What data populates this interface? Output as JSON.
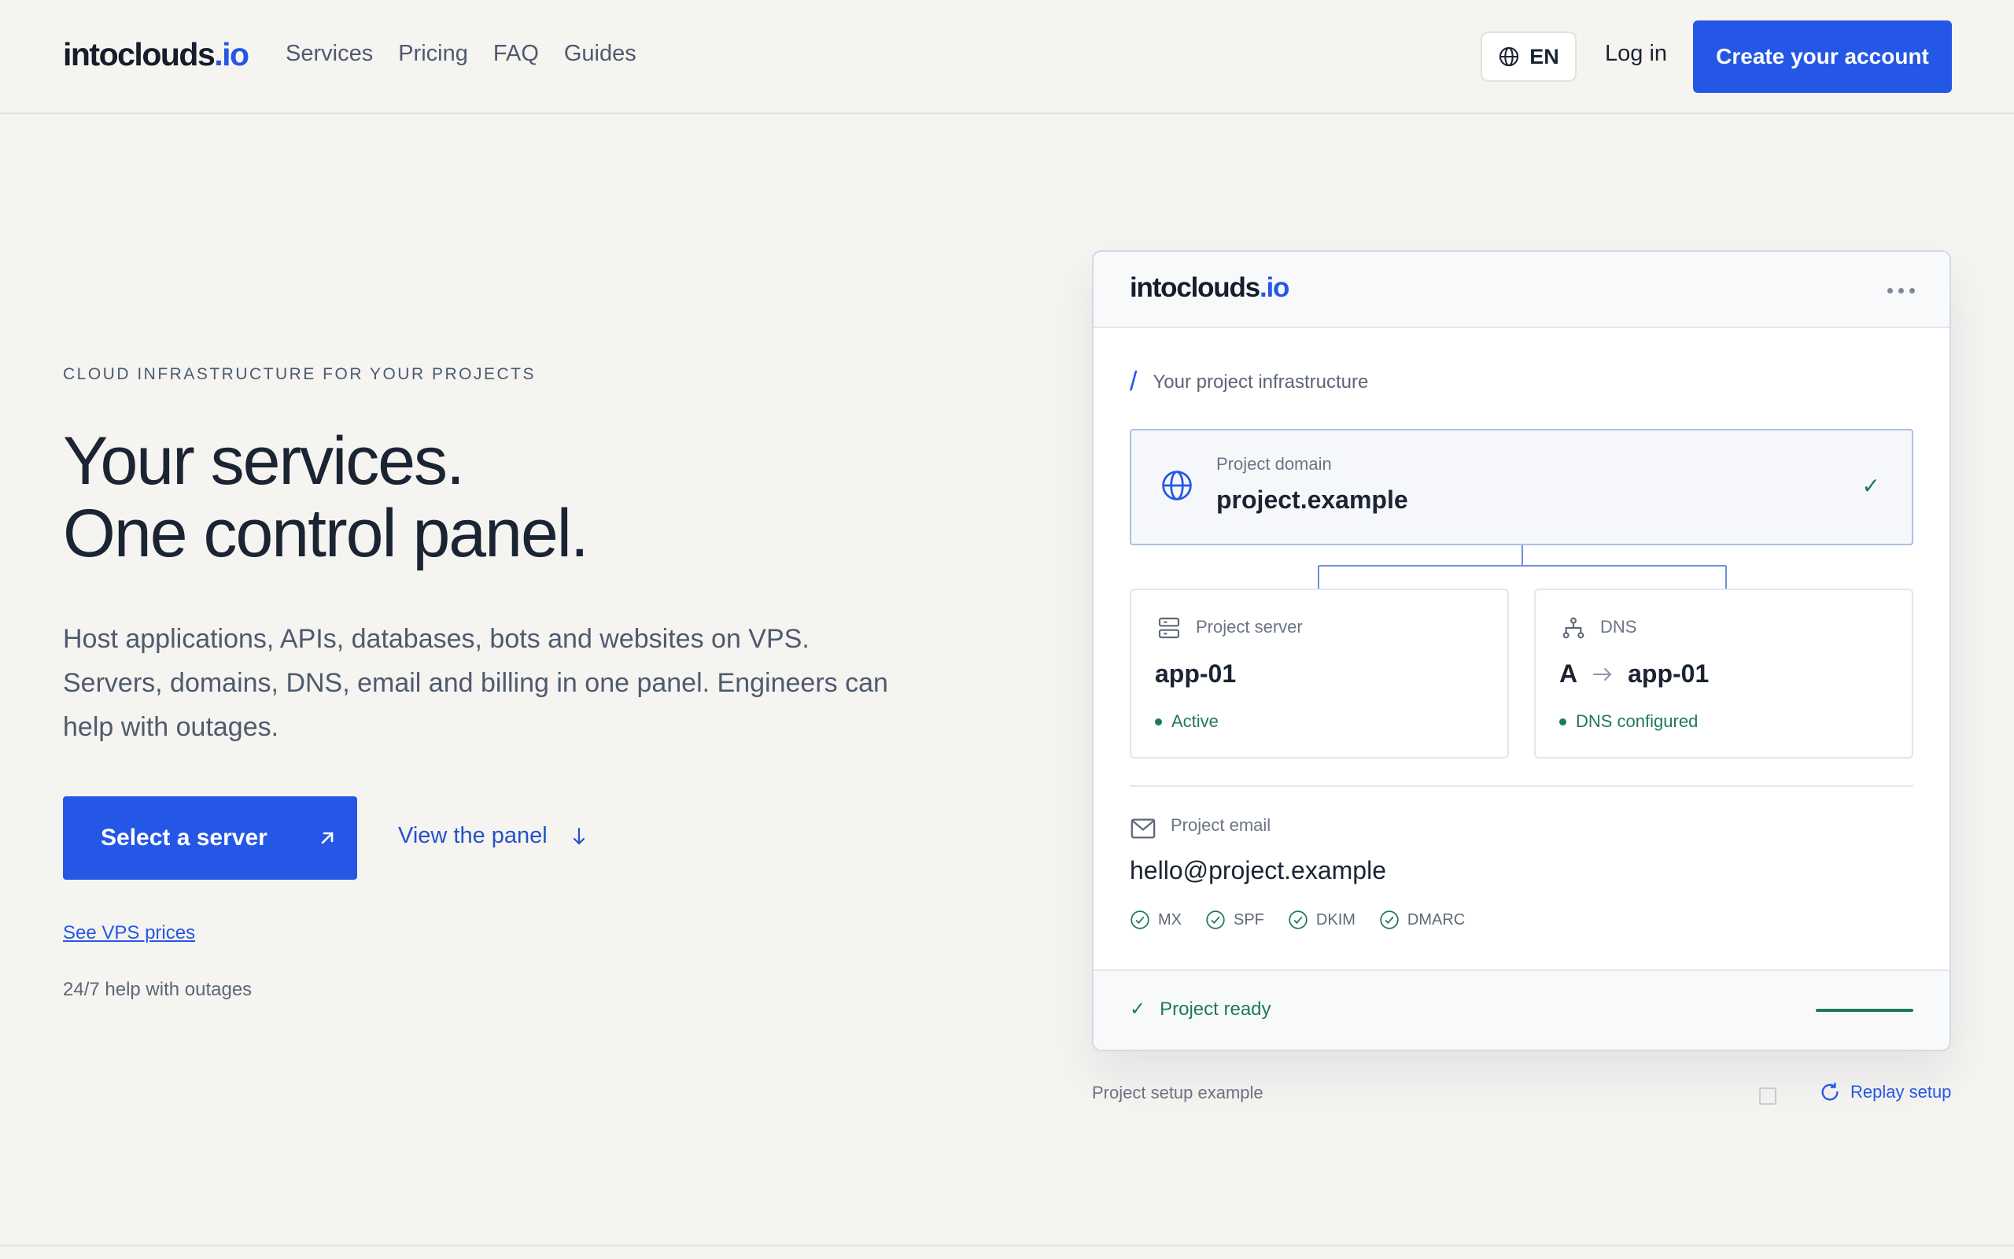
{
  "header": {
    "logo": {
      "name": "intoclouds",
      "tld": ".io"
    },
    "nav": [
      "Services",
      "Pricing",
      "FAQ",
      "Guides"
    ],
    "language": "EN",
    "login": "Log in",
    "create_account": "Create your account"
  },
  "hero": {
    "eyebrow": "CLOUD INFRASTRUCTURE FOR YOUR PROJECTS",
    "headline_line1": "Your services.",
    "headline_line2": "One control panel.",
    "lead": "Host applications, APIs, databases, bots and websites on VPS. Servers, domains, DNS, email and billing in one panel. Engineers can help with outages.",
    "primary_cta": "Select a server",
    "secondary_cta": "View the panel",
    "see_prices": "See VPS prices",
    "help": "24/7 help with outages"
  },
  "panel": {
    "logo": {
      "name": "intoclouds",
      "tld": ".io"
    },
    "breadcrumb": "Your project infrastructure",
    "domain": {
      "label": "Project domain",
      "value": "project.example"
    },
    "server": {
      "label": "Project server",
      "value": "app-01",
      "status": "Active"
    },
    "dns": {
      "label": "DNS",
      "record": "A",
      "target": "app-01",
      "status": "DNS configured"
    },
    "email": {
      "label": "Project email",
      "value": "hello@project.example",
      "records": [
        "MX",
        "SPF",
        "DKIM",
        "DMARC"
      ]
    },
    "footer_status": "Project ready"
  },
  "below_panel": {
    "caption": "Project setup example",
    "replay": "Replay setup"
  },
  "colors": {
    "accent": "#2557e6",
    "success": "#1e7a57",
    "background": "#f5f4f1"
  }
}
